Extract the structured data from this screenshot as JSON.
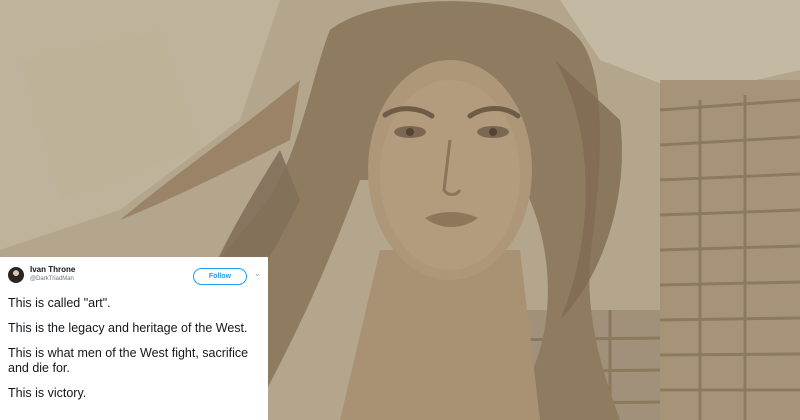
{
  "tweet": {
    "author_name": "Ivan Throne",
    "author_handle": "@DarkTriadMan",
    "follow_label": "Follow",
    "caret_icon": "chevron-down-icon",
    "paragraphs": [
      "This is called \"art\".",
      "This is the legacy and heritage of the West.",
      "This is what men of the West fight, sacrifice and die for.",
      "This is victory."
    ]
  },
  "colors": {
    "accent": "#1da1f2",
    "text": "#14171a",
    "sepia_background": "#a99a7e"
  }
}
